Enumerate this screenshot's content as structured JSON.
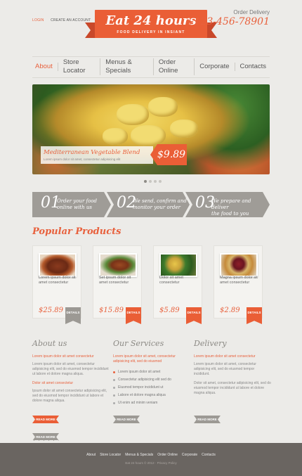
{
  "header": {
    "login": "LOGIN",
    "create_account": "CREATE AN ACCOUNT",
    "logo_title": "Eat 24 hours",
    "logo_subtitle": "FOOD DELIVERY IN INSIANT",
    "order_label": "Order Delivery",
    "order_phone": "+123-456-78901"
  },
  "nav": [
    "About",
    "Store Locator",
    "Menus & Specials",
    "Order Online",
    "Corporate",
    "Contacts"
  ],
  "slider": {
    "caption_title": "Mediterranean Vegetable Blend",
    "caption_sub": "Lorem ipsum dolor sit amet, consectetur adipisicing elit",
    "price": "$9.89"
  },
  "steps": [
    {
      "num": "01",
      "line1": "Order your food",
      "line2": "online with us"
    },
    {
      "num": "02",
      "line1": "We send, confirm and",
      "line2": "monitor your order"
    },
    {
      "num": "03",
      "line1": "We prepare and deliver",
      "line2": "the food to you"
    }
  ],
  "popular_title": "Popular Products",
  "products": [
    {
      "name": "Lorem ipsum dolor sit amet consectetur",
      "price": "$25.89",
      "details": "DETAILS",
      "color": "#9c9994"
    },
    {
      "name": "Set ipsum dolor sit amet consectetur",
      "price": "$15.89",
      "details": "DETAILS",
      "color": "#ea5e36"
    },
    {
      "name": "Dolor sit amet consectetur",
      "price": "$5.89",
      "details": "DETAILS",
      "color": "#ea5e36"
    },
    {
      "name": "Magna ipsum dolor sit amet consectetur",
      "price": "$2.89",
      "details": "DETAILS",
      "color": "#ea5e36"
    }
  ],
  "about": {
    "title": "About us",
    "highlight": "Lorem ipsum dolor sit amet consectetur",
    "p1": "Lorem ipsum dolor sit amet, consectetur adipisicing elit, sed do eiusmod tempor incididunt ut labore et dolore magna aliqua.",
    "highlight2": "Dolor sit amet consectetur",
    "p2": "Ipsum dolor sit amet consectetur adipisicing elit, sed do eiusmod tempor incididunt ut labore et dolore magna aliqua.",
    "more": "READ MORE"
  },
  "services": {
    "title": "Our Services",
    "highlight": "Lorem ipsum dolor sit amet, consectetur adipisicing elit, sed do eiusmod",
    "items": [
      "Lorem ipsum dolor sit amet",
      "Consectetur adipisicing elit sed do",
      "Eiusmod tempor incididunt ut",
      "Labore et dolore magna aliqua",
      "Ut enim ad minim veniam"
    ],
    "more": "READ MORE"
  },
  "delivery": {
    "title": "Delivery",
    "highlight": "Lorem ipsum dolor sit amet consectetur",
    "p1": "Lorem ipsum dolor sit amet, consectetur adipisicing elit, sed do eiusmod tempor incididunt.",
    "p2": "Dolor sit amet, consectetur adipisicing elit, sed do eiusmod tempor incididunt ut labore et dolore magna aliqua.",
    "more": "READ MORE"
  },
  "footer": {
    "nav": [
      "About",
      "Store Locator",
      "Menus & Specials",
      "Order Online",
      "Corporate",
      "Contacts"
    ],
    "copyright": "Eat 24 hours © 2012 · Privacy Policy"
  },
  "colors": {
    "accent": "#ea5e36",
    "grey": "#9c9994",
    "footer": "#6a6561"
  }
}
